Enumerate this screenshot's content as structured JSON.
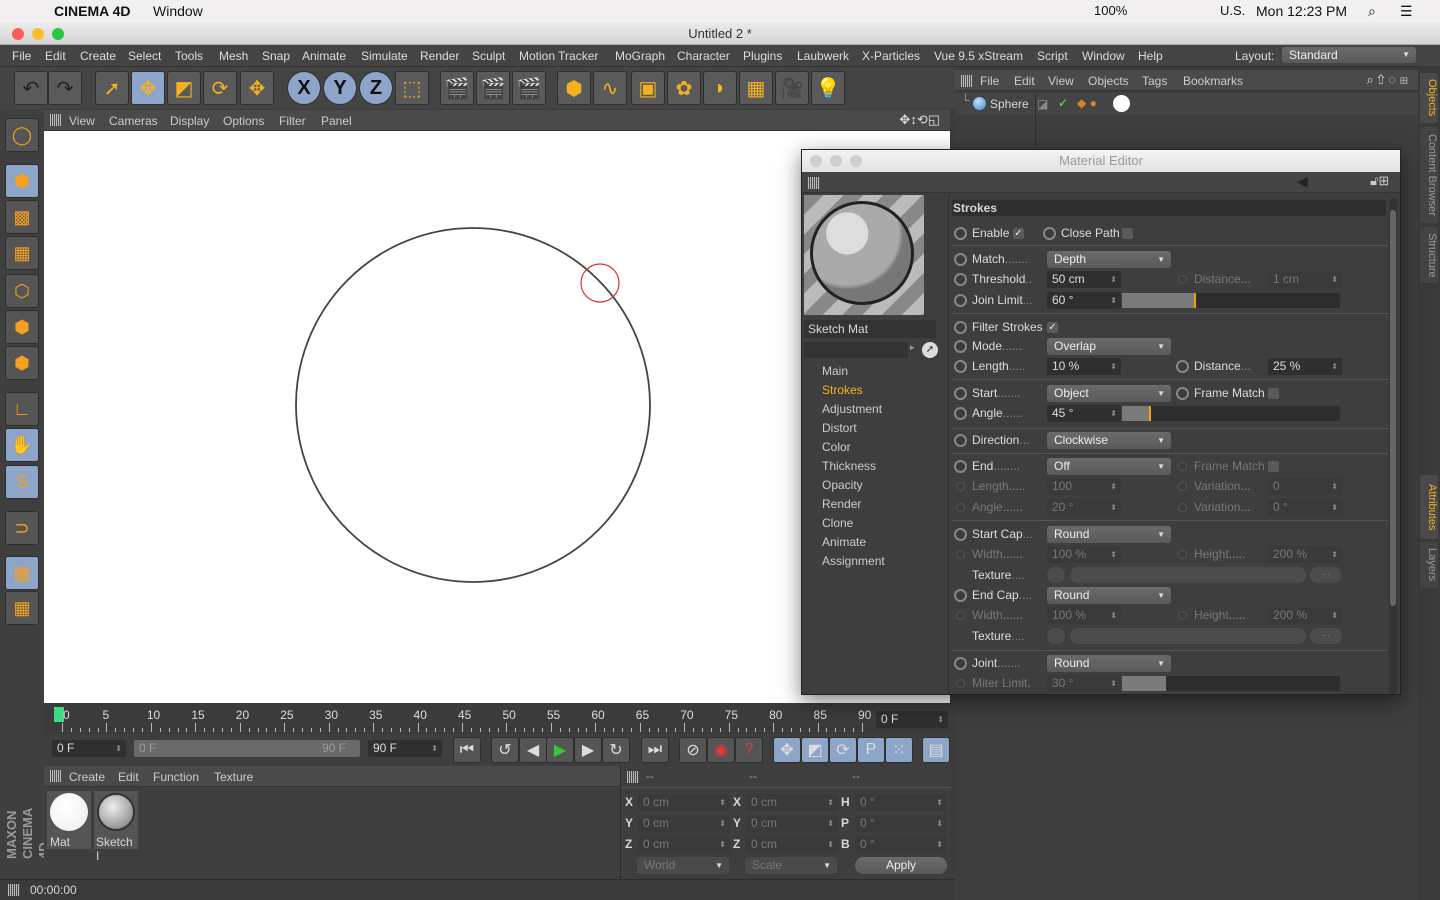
{
  "os_menubar": {
    "app_name": "CINEMA 4D",
    "menu": "Window",
    "status": [
      "100%",
      "U.S.",
      "Mon 12:23 PM"
    ],
    "battery": "100%"
  },
  "window": {
    "title": "Untitled 2 *"
  },
  "main_menu": [
    "File",
    "Edit",
    "Create",
    "Select",
    "Tools",
    "Mesh",
    "Snap",
    "Animate",
    "Simulate",
    "Render",
    "Sculpt",
    "Motion Tracker",
    "MoGraph",
    "Character",
    "Plugins",
    "Laubwerk",
    "X-Particles",
    "Vue 9.5 xStream",
    "Script",
    "Window",
    "Help"
  ],
  "layout": {
    "label": "Layout:",
    "value": "Standard"
  },
  "toolbar": [
    {
      "icon": "undo-icon",
      "glyph": "↶"
    },
    {
      "icon": "redo-icon",
      "glyph": "↷"
    },
    {
      "icon": "live-selection-icon",
      "glyph": "➚"
    },
    {
      "icon": "move-icon",
      "glyph": "✥",
      "on": true
    },
    {
      "icon": "scale-icon",
      "glyph": "◩"
    },
    {
      "icon": "rotate-icon",
      "glyph": "⟳"
    },
    {
      "icon": "recent-tool-icon",
      "glyph": "✥"
    },
    {
      "icon": "x-axis-icon",
      "glyph": "X",
      "on": true
    },
    {
      "icon": "y-axis-icon",
      "glyph": "Y",
      "on": true
    },
    {
      "icon": "z-axis-icon",
      "glyph": "Z",
      "on": true
    },
    {
      "icon": "coordinate-system-icon",
      "glyph": "⬚"
    },
    {
      "icon": "render-view-icon",
      "glyph": "🎬"
    },
    {
      "icon": "render-picture-viewer-icon",
      "glyph": "🎬"
    },
    {
      "icon": "render-settings-icon",
      "glyph": "🎬"
    },
    {
      "icon": "cube-icon",
      "glyph": "⬢"
    },
    {
      "icon": "spline-pen-icon",
      "glyph": "∿"
    },
    {
      "icon": "subdivision-icon",
      "glyph": "▣"
    },
    {
      "icon": "mograph-cloner-icon",
      "glyph": "✿"
    },
    {
      "icon": "deformer-icon",
      "glyph": "◗"
    },
    {
      "icon": "floor-icon",
      "glyph": "▦"
    },
    {
      "icon": "camera-icon",
      "glyph": "🎥"
    },
    {
      "icon": "light-icon",
      "glyph": "💡"
    }
  ],
  "left_toolbar": [
    "make-editable-icon",
    "model-mode-icon",
    "texture-mode-icon",
    "workplane-icon",
    "points-mode-icon",
    "edges-mode-icon",
    "polygons-mode-icon",
    "axis-mode-icon",
    "tweak-mode-icon",
    "solo-icon",
    "snap-icon",
    "workplane-lock-icon",
    "planar-workplane-icon"
  ],
  "viewport": {
    "menu": [
      "View",
      "Cameras",
      "Display",
      "Options",
      "Filter",
      "Panel"
    ]
  },
  "timeline": {
    "labels": [
      "0",
      "5",
      "10",
      "15",
      "20",
      "25",
      "30",
      "35",
      "40",
      "45",
      "50",
      "55",
      "60",
      "65",
      "70",
      "75",
      "80",
      "85",
      "90"
    ],
    "current_frame": "0 F",
    "start": "0 F",
    "range_start": "0 F",
    "range_end": "90 F",
    "end": "90 F",
    "playhead_color": "#3ddc84"
  },
  "material_manager": {
    "menu": [
      "Create",
      "Edit",
      "Function",
      "Texture"
    ],
    "materials": [
      {
        "name": "Mat"
      },
      {
        "name": "Sketch Mat"
      }
    ],
    "materials_display": [
      "Mat",
      "Sketch I"
    ]
  },
  "coordinates": {
    "headers": [
      "--",
      "--",
      "--"
    ],
    "rows": [
      {
        "a": "X",
        "av": "0 cm",
        "b": "X",
        "bv": "0 cm",
        "c": "H",
        "cv": "0 °"
      },
      {
        "a": "Y",
        "av": "0 cm",
        "b": "Y",
        "bv": "0 cm",
        "c": "P",
        "cv": "0 °"
      },
      {
        "a": "Z",
        "av": "0 cm",
        "b": "Z",
        "bv": "0 cm",
        "c": "B",
        "cv": "0 °"
      }
    ],
    "space": "World",
    "mode": "Scale",
    "apply": "Apply"
  },
  "status": {
    "time": "00:00:00"
  },
  "logo": "MAXON CINEMA 4D",
  "object_manager": {
    "menu": [
      "File",
      "Edit",
      "View",
      "Objects",
      "Tags",
      "Bookmarks"
    ],
    "objects": [
      {
        "name": "Sphere"
      }
    ]
  },
  "right_tabs": [
    "Objects",
    "Content Browser",
    "Structure",
    "Attributes",
    "Layers"
  ],
  "material_editor": {
    "title": "Material Editor",
    "material_name": "Sketch Mat",
    "channels": [
      "Main",
      "Strokes",
      "Adjustment",
      "Distort",
      "Color",
      "Thickness",
      "Opacity",
      "Render",
      "Clone",
      "Animate",
      "Assignment"
    ],
    "active_channel": "Strokes",
    "section": "Strokes",
    "rows": [
      {
        "label": "Enable",
        "check": "✓",
        "label2": "Close Path",
        "check2": ""
      },
      {
        "label": "Match",
        "dots": ".......",
        "drop": "Depth"
      },
      {
        "label": "Threshold",
        "dots": "..",
        "field": "50 cm",
        "r_label": "Distance",
        "r_dots": "...",
        "r_field": "1 cm",
        "r_dis": true
      },
      {
        "label": "Join Limit",
        "dots": "...",
        "field": "60 °",
        "slider": 0.33
      },
      {
        "label": "Filter Strokes",
        "check": "✓"
      },
      {
        "label": "Mode",
        "dots": "......",
        "drop": "Overlap"
      },
      {
        "label": "Length",
        "dots": ".....",
        "field": "10 %",
        "r_label": "Distance",
        "r_dots": "...",
        "r_field": "25 %"
      },
      {
        "label": "Start",
        "dots": ".......",
        "drop": "Object",
        "r_label": "Frame Match",
        "r_check": ""
      },
      {
        "label": "Angle",
        "dots": "......",
        "field": "45 °",
        "slider": 0.125
      },
      {
        "label": "Direction",
        "dots": "...",
        "drop": "Clockwise"
      },
      {
        "label": "End",
        "dots": "........",
        "drop": "Off",
        "r_label": "Frame Match",
        "r_check": "",
        "r_dis": true
      },
      {
        "label": "Length",
        "dots": ".....",
        "field": "100",
        "dis": true,
        "r_label": "Variation",
        "r_dots": "...",
        "r_field": "0",
        "r_dis": true
      },
      {
        "label": "Angle",
        "dots": "......",
        "field": "20 °",
        "dis": true,
        "r_label": "Variation",
        "r_dots": "...",
        "r_field": "0 °",
        "r_dis": true
      },
      {
        "label": "Start Cap",
        "dots": "...",
        "drop": "Round"
      },
      {
        "label": "Width",
        "dots": "......",
        "field": "100 %",
        "dis": true,
        "r_label": "Height",
        "r_dots": ".....",
        "r_field": "200 %",
        "r_dis": true
      },
      {
        "label": "Texture",
        "dots": "....",
        "texture": true,
        "noradio": true,
        "button": "..."
      },
      {
        "label": "End Cap",
        "dots": "....",
        "drop": "Round"
      },
      {
        "label": "Width",
        "dots": "......",
        "field": "100 %",
        "dis": true,
        "r_label": "Height",
        "r_dots": ".....",
        "r_field": "200 %",
        "r_dis": true
      },
      {
        "label": "Texture",
        "dots": "....",
        "texture": true,
        "noradio": true,
        "button": "..."
      },
      {
        "label": "Joint",
        "dots": ".......",
        "drop": "Round"
      },
      {
        "label": "Miter Limit",
        "dots": ".",
        "field": "30 °",
        "dis": true,
        "slider": 0.2
      }
    ]
  },
  "colors": {
    "accent": "#f5a000",
    "selected_tool": "#8ca5c8",
    "active_tab": "#f5b021"
  }
}
